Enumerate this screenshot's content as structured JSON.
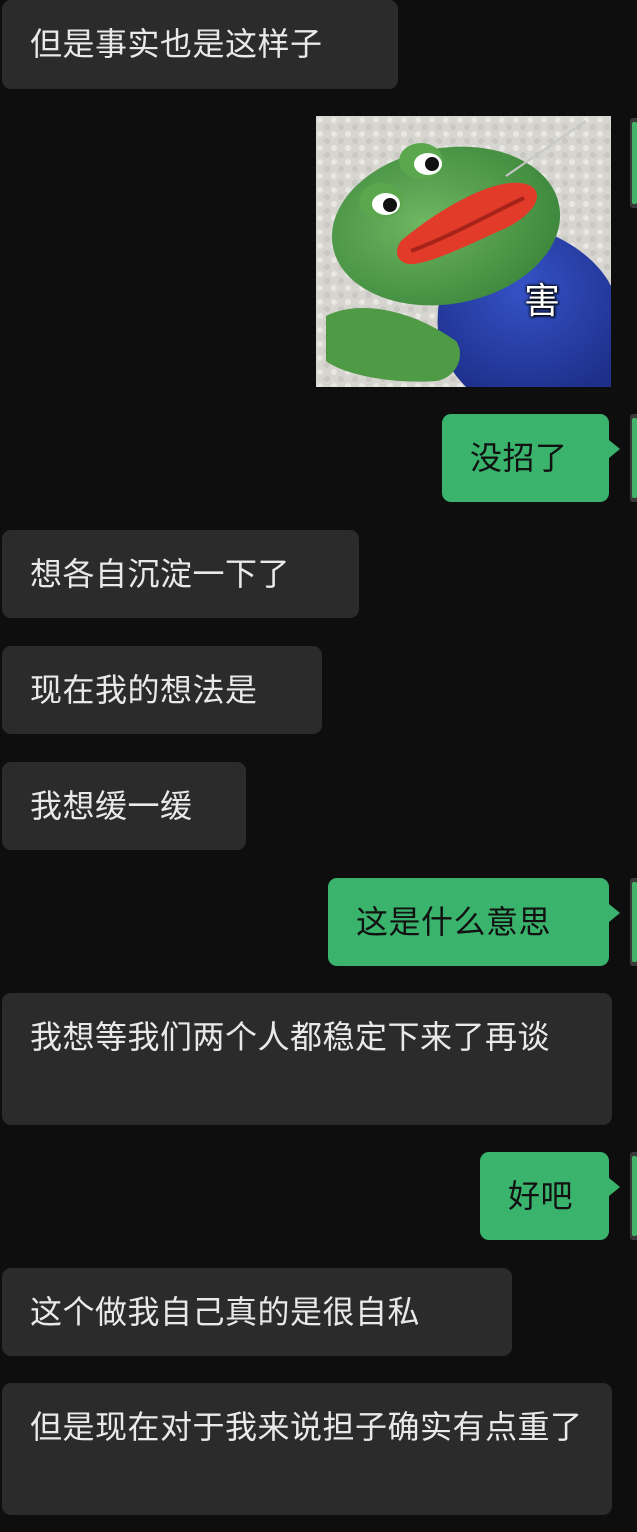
{
  "messages": [
    {
      "side": "in",
      "text": "但是事实也是这样子"
    },
    {
      "side": "out",
      "type": "sticker",
      "caption": "害",
      "icon": "pepe-frog-sticker"
    },
    {
      "side": "out",
      "text": "没招了"
    },
    {
      "side": "in",
      "text": "想各自沉淀一下了"
    },
    {
      "side": "in",
      "text": "现在我的想法是"
    },
    {
      "side": "in",
      "text": "我想缓一缓"
    },
    {
      "side": "out",
      "text": "这是什么意思"
    },
    {
      "side": "in",
      "text": "我想等我们两个人都稳定下来了再谈"
    },
    {
      "side": "out",
      "text": "好吧"
    },
    {
      "side": "in",
      "text": "这个做我自己真的是很自私"
    },
    {
      "side": "in",
      "text": "但是现在对于我来说担子确实有点重了"
    }
  ],
  "colors": {
    "background": "#0e0e0e",
    "incoming_bubble": "#2b2b2b",
    "outgoing_bubble": "#3ab36c",
    "incoming_text": "#e9e9e9",
    "outgoing_text": "#111111"
  }
}
